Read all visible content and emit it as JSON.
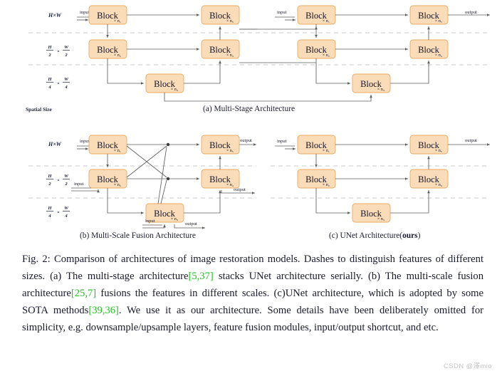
{
  "figure": {
    "label": "Fig. 2:",
    "watermark": "CSDN @澤mio"
  },
  "axis": {
    "full_size": "H×W",
    "half_num": "H",
    "half_den": "2",
    "half_times": "×",
    "half_num2": "W",
    "half_den2": "2",
    "quarter_num": "H",
    "quarter_den": "4",
    "quarter_num2": "W",
    "quarter_den2": "4",
    "spatial_size_label": "Spatial Size"
  },
  "blocks": {
    "name": "Block",
    "n1": "× n₁",
    "n2": "× n₂",
    "n3": "× n₃",
    "n4": "× n₄",
    "n5": "× n₅"
  },
  "io": {
    "input": "input",
    "output": "output"
  },
  "subcaptions": {
    "a": "(a) Multi-Stage Architecture",
    "b": "(b) Multi-Scale Fusion Architecture",
    "c_prefix": "(c) UNet Architecture(",
    "c_bold": "ours",
    "c_suffix": ")"
  },
  "caption": {
    "seg1": "Fig. 2: Comparison of architectures of image restoration models. Dashes to distinguish features of different sizes. (a) The multi-stage architecture",
    "cite1": "[5,37]",
    "seg2": " stacks UNet architecture serially. (b) The multi-scale fusion architecture",
    "cite2": "[25,7]",
    "seg3": " fusions the features in different scales. (c)UNet architecture, which is adopted by some SOTA methods",
    "cite3": "[39,36]",
    "seg4": ". We use it as our architecture. Some details have been deliberately omitted for simplicity, e.g. downsample/upsample layers, feature fusion modules, input/output shortcut, and etc."
  },
  "colors": {
    "block_fill": "#fadcb8",
    "block_stroke": "#e8a963",
    "edge": "#5e5e5e",
    "dash": "#c9c9c9",
    "citation": "#22c322",
    "watermark": "#c4c4c4"
  }
}
